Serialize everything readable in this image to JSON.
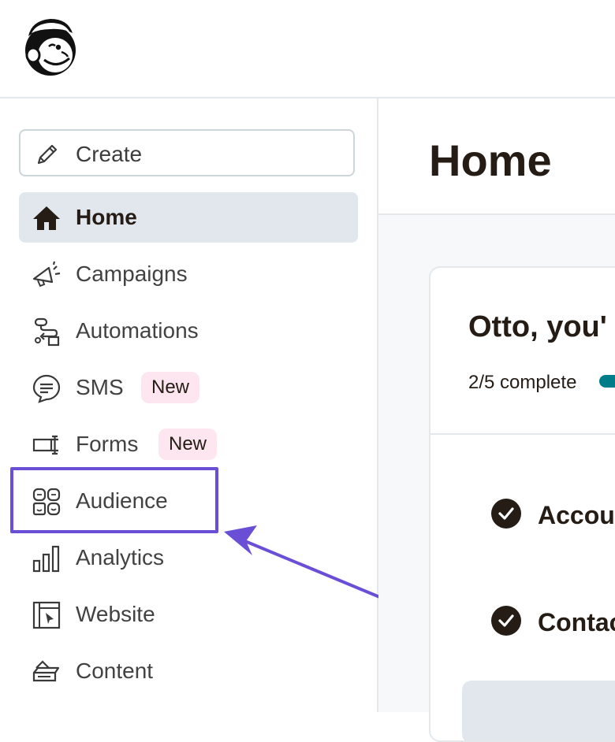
{
  "sidebar": {
    "create_label": "Create",
    "items": [
      {
        "key": "home",
        "label": "Home",
        "icon": "home-icon",
        "active": true
      },
      {
        "key": "campaigns",
        "label": "Campaigns",
        "icon": "megaphone-icon"
      },
      {
        "key": "automations",
        "label": "Automations",
        "icon": "automations-icon"
      },
      {
        "key": "sms",
        "label": "SMS",
        "icon": "chat-bubble-icon",
        "badge": "New"
      },
      {
        "key": "forms",
        "label": "Forms",
        "icon": "form-icon",
        "badge": "New"
      },
      {
        "key": "audience",
        "label": "Audience",
        "icon": "audience-icon",
        "highlighted": true
      },
      {
        "key": "analytics",
        "label": "Analytics",
        "icon": "bar-chart-icon"
      },
      {
        "key": "website",
        "label": "Website",
        "icon": "website-icon"
      },
      {
        "key": "content",
        "label": "Content",
        "icon": "content-icon"
      }
    ]
  },
  "main": {
    "title": "Home",
    "card": {
      "title": "Otto, you'",
      "progress_text": "2/5 complete",
      "progress": {
        "done": 2,
        "total": 5
      },
      "tasks": [
        {
          "label": "Accou",
          "done": true
        },
        {
          "label": "Contac",
          "done": true
        }
      ]
    }
  },
  "annotations": {
    "highlight_color": "#6a4fd6"
  },
  "colors": {
    "active_nav_bg": "#e1e7ed",
    "badge_bg": "#fde6f0",
    "progress": "#007c89",
    "text": "#241c15"
  }
}
